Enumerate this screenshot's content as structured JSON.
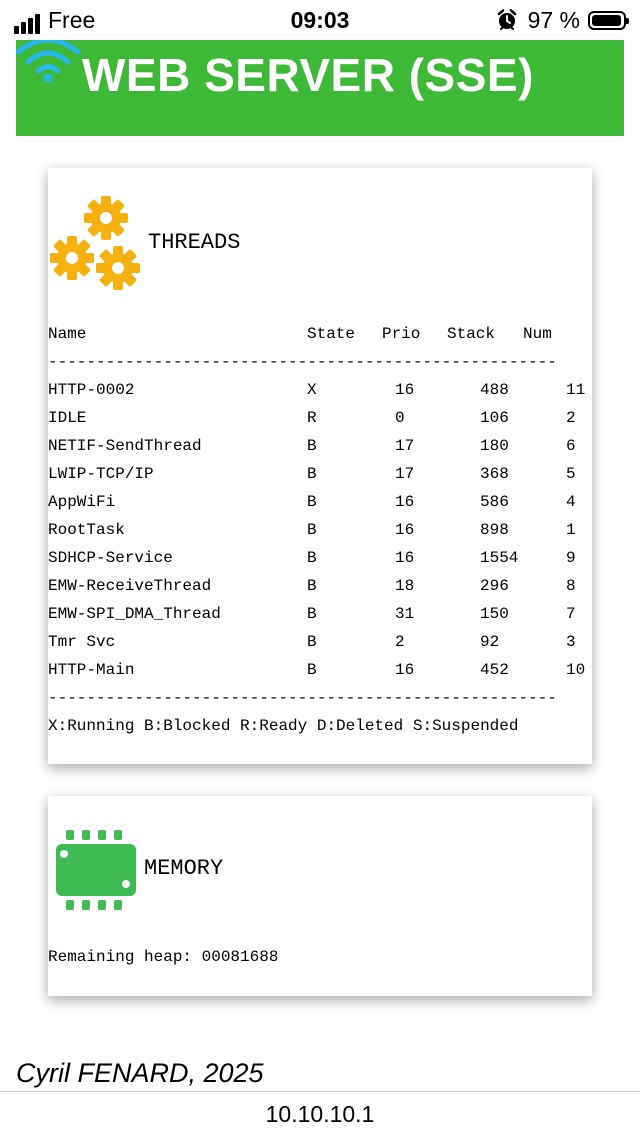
{
  "status_bar": {
    "carrier": "Free",
    "time": "09:03",
    "battery_percent": "97 %",
    "battery_level": 0.97,
    "icons": [
      "signal-icon",
      "alarm-icon",
      "battery-icon"
    ]
  },
  "header": {
    "title": "WEB SERVER (SSE)",
    "color": "#3db837",
    "icon": "wifi-icon"
  },
  "threads": {
    "title": "THREADS",
    "icon": "gears-icon",
    "columns": {
      "name": "Name",
      "state": "State",
      "prio": "Prio",
      "stack": "Stack",
      "num": "Num"
    },
    "separator": "-----------------------------------------------------",
    "rows": [
      {
        "name": "HTTP-0002",
        "state": "X",
        "prio": "16",
        "stack": "488",
        "num": "11"
      },
      {
        "name": "IDLE",
        "state": "R",
        "prio": "0",
        "stack": "106",
        "num": "2"
      },
      {
        "name": "NETIF-SendThread",
        "state": "B",
        "prio": "17",
        "stack": "180",
        "num": "6"
      },
      {
        "name": "LWIP-TCP/IP",
        "state": "B",
        "prio": "17",
        "stack": "368",
        "num": "5"
      },
      {
        "name": "AppWiFi",
        "state": "B",
        "prio": "16",
        "stack": "586",
        "num": "4"
      },
      {
        "name": "RootTask",
        "state": "B",
        "prio": "16",
        "stack": "898",
        "num": "1"
      },
      {
        "name": "SDHCP-Service",
        "state": "B",
        "prio": "16",
        "stack": "1554",
        "num": "9"
      },
      {
        "name": "EMW-ReceiveThread",
        "state": "B",
        "prio": "18",
        "stack": "296",
        "num": "8"
      },
      {
        "name": "EMW-SPI_DMA_Thread",
        "state": "B",
        "prio": "31",
        "stack": "150",
        "num": "7"
      },
      {
        "name": "Tmr Svc",
        "state": "B",
        "prio": "2",
        "stack": "92",
        "num": "3"
      },
      {
        "name": "HTTP-Main",
        "state": "B",
        "prio": "16",
        "stack": "452",
        "num": "10"
      }
    ],
    "legend": "X:Running B:Blocked R:Ready D:Deleted S:Suspended"
  },
  "memory": {
    "title": "MEMORY",
    "icon": "chip-icon",
    "heap_text": "Remaining heap: 00081688"
  },
  "footer": {
    "author": "Cyril FENARD, 2025",
    "url": "10.10.10.1"
  }
}
